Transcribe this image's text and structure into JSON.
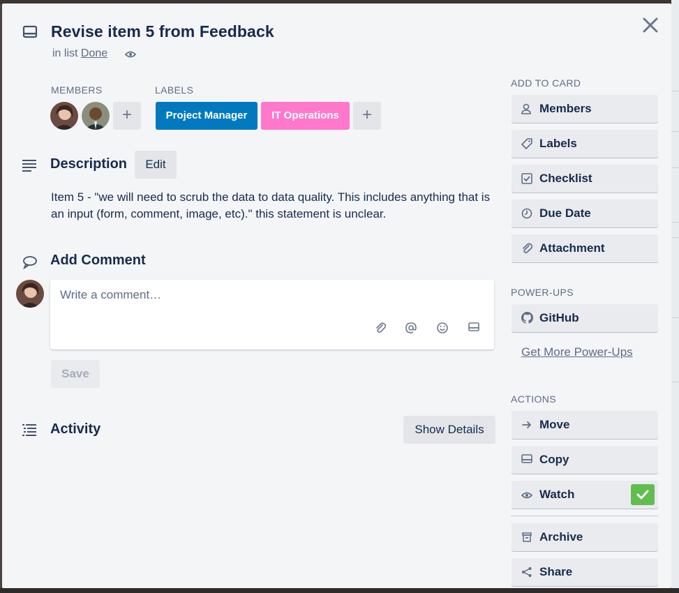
{
  "card": {
    "title": "Revise item 5 from Feedback",
    "list_prefix": "in list",
    "list_name": "Done"
  },
  "members": {
    "label": "MEMBERS",
    "avatars": [
      "member-avatar-1",
      "member-avatar-2"
    ]
  },
  "labels": {
    "label": "LABELS",
    "items": [
      {
        "text": "Project Manager",
        "color": "#0079bf"
      },
      {
        "text": "IT Operations",
        "color": "#ff78cb"
      }
    ]
  },
  "description": {
    "heading": "Description",
    "edit_label": "Edit",
    "text": "Item 5 - \"we will need to scrub the data to data quality. This includes anything that is an input (form, comment, image, etc).\" this statement is unclear."
  },
  "comment": {
    "heading": "Add Comment",
    "placeholder": "Write a comment…",
    "save_label": "Save"
  },
  "activity": {
    "heading": "Activity",
    "show_details_label": "Show Details"
  },
  "sidebar": {
    "add_to_card": {
      "label": "ADD TO CARD",
      "items": [
        {
          "text": "Members",
          "icon": "person-icon"
        },
        {
          "text": "Labels",
          "icon": "tag-icon"
        },
        {
          "text": "Checklist",
          "icon": "checkbox-icon"
        },
        {
          "text": "Due Date",
          "icon": "clock-icon"
        },
        {
          "text": "Attachment",
          "icon": "paperclip-icon"
        }
      ]
    },
    "power_ups": {
      "label": "POWER-UPS",
      "items": [
        {
          "text": "GitHub",
          "icon": "github-icon"
        }
      ],
      "get_more": "Get More Power-Ups"
    },
    "actions": {
      "label": "ACTIONS",
      "items": [
        {
          "text": "Move",
          "icon": "arrow-right-icon"
        },
        {
          "text": "Copy",
          "icon": "card-icon"
        },
        {
          "text": "Watch",
          "icon": "eye-icon",
          "checked": true
        },
        {
          "text": "Archive",
          "icon": "archive-icon"
        },
        {
          "text": "Share",
          "icon": "share-icon"
        }
      ]
    }
  },
  "colors": {
    "label_blue": "#0079bf",
    "label_pink": "#ff78cb",
    "watch_check": "#61bd4f",
    "text_dark": "#172b4d",
    "text_muted": "#5e6c84",
    "modal_bg": "#f4f5f7"
  }
}
